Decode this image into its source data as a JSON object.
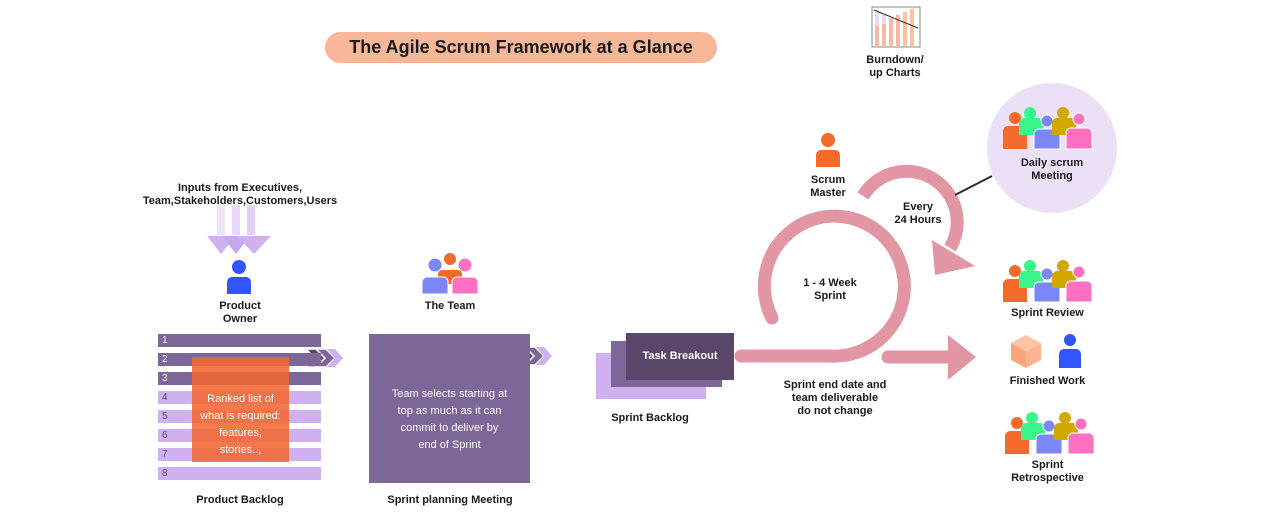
{
  "title": "The Agile Scrum Framework at a Glance",
  "colors": {
    "title_bg": "#f9b79a",
    "backlog_dark": "#7d6698",
    "backlog_light": "#cfb1ef",
    "ranked_overlay": "#f36832",
    "task_breakout": "#594668",
    "sprint_loop": "#e295a2",
    "daily_circle": "#ece0f7",
    "product_owner": "#3355ff",
    "scrum_master": "#f36a2a"
  },
  "inputs": {
    "line1": "Inputs from Executives,",
    "line2": "Team,Stakeholders,Customers,Users"
  },
  "product_owner": {
    "line1": "Product",
    "line2": "Owner",
    "icon": "person-icon"
  },
  "product_backlog": {
    "label": "Product Backlog",
    "rows": [
      "1",
      "2",
      "3",
      "4",
      "5",
      "6",
      "7",
      "8"
    ],
    "ranked_text": [
      "Ranked list of",
      "what is required:",
      "features,",
      "stories..,"
    ]
  },
  "team": {
    "label": "The Team",
    "icon": "team-icon"
  },
  "sprint_planning": {
    "label": "Sprint planning Meeting",
    "text": [
      "Team selects starting at",
      "top as much as it can",
      "commit to deliver by",
      "end of Sprint"
    ]
  },
  "sprint_backlog": {
    "label": "Sprint Backlog",
    "task_breakout": "Task Breakout"
  },
  "scrum_master": {
    "line1": "Scrum",
    "line2": "Master",
    "icon": "person-icon"
  },
  "sprint_cycle": {
    "sprint_line1": "1 - 4 Week",
    "sprint_line2": "Sprint",
    "daily_line1": "Every",
    "daily_line2": "24 Hours",
    "end_line1": "Sprint end date and",
    "end_line2": "team deliverable",
    "end_line3": "do not change"
  },
  "burndown": {
    "line1": "Burndown/",
    "line2": "up Charts",
    "icon": "burndown-chart-icon"
  },
  "daily_scrum": {
    "line1": "Daily scrum",
    "line2": "Meeting"
  },
  "sprint_review": {
    "label": "Sprint Review"
  },
  "finished_work": {
    "label": "Finished Work"
  },
  "sprint_retrospective": {
    "line1": "Sprint",
    "line2": "Retrospective"
  }
}
